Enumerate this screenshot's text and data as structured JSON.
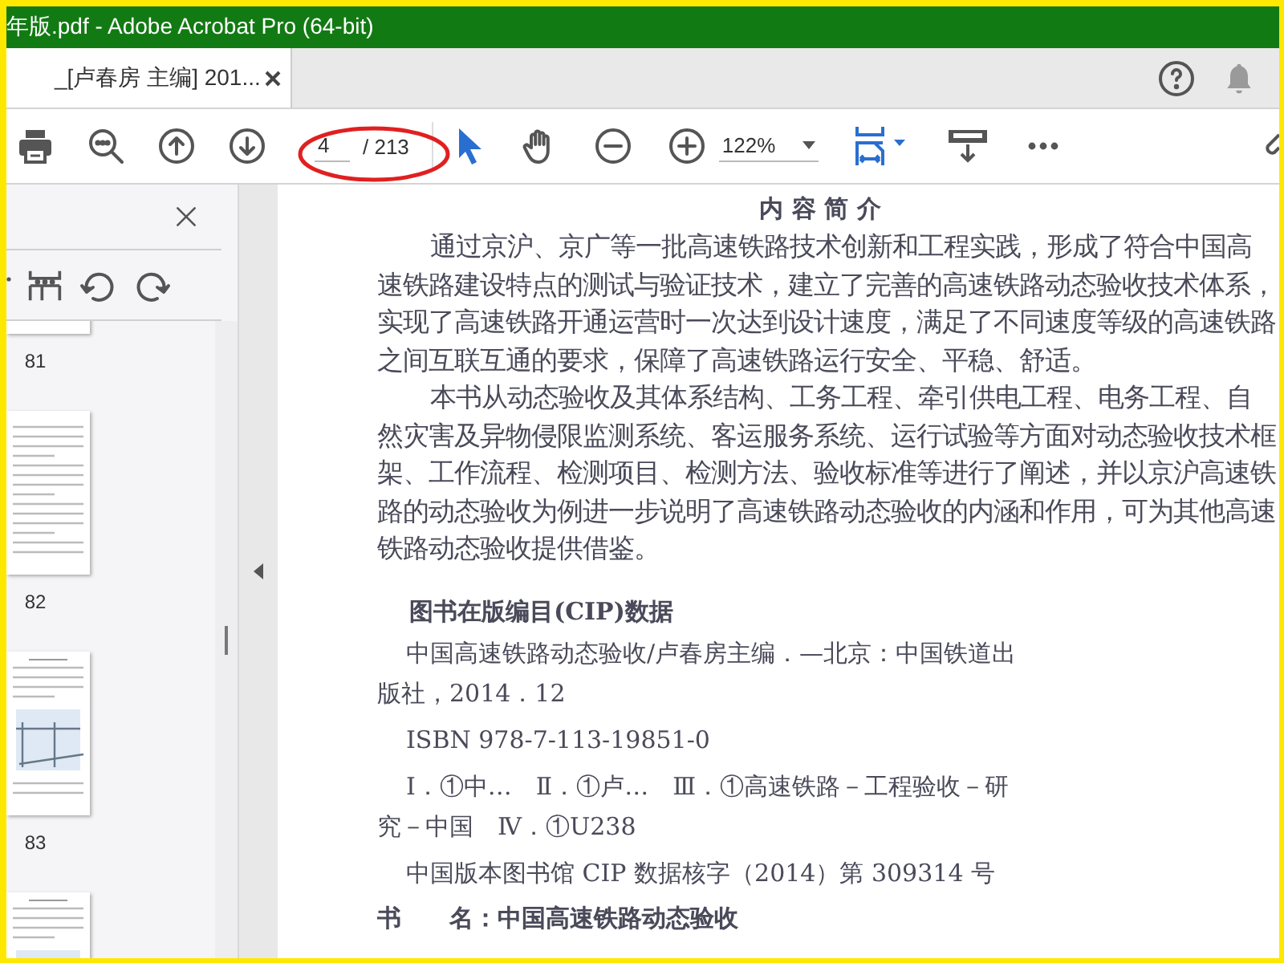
{
  "window": {
    "title": "年版.pdf - Adobe Acrobat Pro (64-bit)"
  },
  "tabs": [
    {
      "label": "_[卢春房 主编] 201...",
      "selected": true
    }
  ],
  "toolbar": {
    "page_number": "4",
    "page_count": "/ 213",
    "zoom": "122%"
  },
  "thumbnails": [
    {
      "label": "81",
      "kind": "text"
    },
    {
      "label": "82",
      "kind": "text"
    },
    {
      "label": "83",
      "kind": "figure"
    }
  ],
  "document": {
    "title": "内 容 简 介",
    "paragraphs": [
      "通过京沪、京广等一批高速铁路技术创新和工程实践，形成了符合中国高速铁路建设特点的测试与验证技术，建立了完善的高速铁路动态验收技术体系，实现了高速铁路开通运营时一次达到设计速度，满足了不同速度等级的高速铁路之间互联互通的要求，保障了高速铁路运行安全、平稳、舒适。",
      "本书从动态验收及其体系结构、工务工程、牵引供电工程、电务工程、自然灾害及异物侵限监测系统、客运服务系统、运行试验等方面对动态验收技术框架、工作流程、检测项目、检测方法、验收标准等进行了阐述，并以京沪高速铁路的动态验收为例进一步说明了高速铁路动态验收的内涵和作用，可为其他高速铁路动态验收提供借鉴。"
    ],
    "cip_heading": "图书在版编目(CIP)数据",
    "cip_entries": [
      "中国高速铁路动态验收/卢春房主编．—北京：中国铁道出版社，2014．12",
      "ISBN 978-7-113-19851-0",
      "Ⅰ．①中…　Ⅱ．①卢…　Ⅲ．①高速铁路－工程验收－研究－中国　Ⅳ．①U238",
      "中国版本图书馆 CIP 数据核字（2014）第 309314 号"
    ],
    "book_title": "书　　名：中国高速铁路动态验收"
  }
}
